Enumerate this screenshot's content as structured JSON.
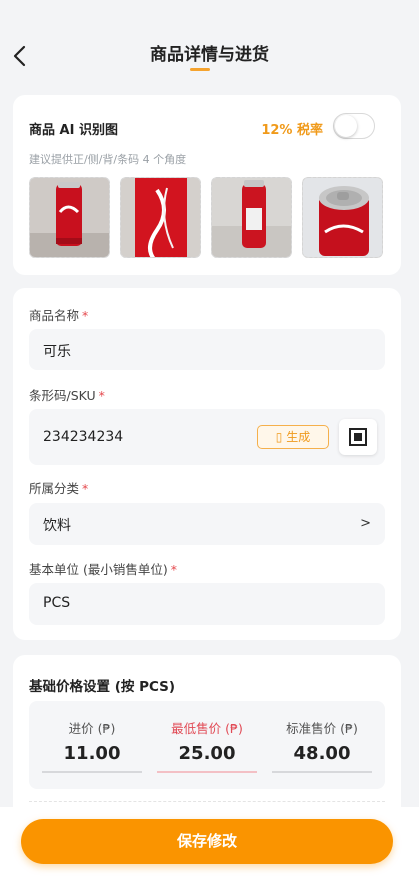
{
  "header": {
    "title": "商品详情与进货"
  },
  "ai_section": {
    "title": "商品 AI 识别图",
    "tax_label": "12% 税率",
    "tax_enabled": false,
    "hint": "建议提供正/侧/背/条码 4 个角度"
  },
  "form": {
    "name": {
      "label": "商品名称",
      "required_mark": "*",
      "value": "可乐"
    },
    "sku": {
      "label": "条形码/SKU",
      "required_mark": "*",
      "value": "234234234",
      "generate_label": "▯ 生成"
    },
    "category": {
      "label": "所属分类",
      "required_mark": "*",
      "value": "饮料",
      "chevron": ">"
    },
    "unit": {
      "label": "基本单位 (最小销售单位)",
      "required_mark": "*",
      "value": "PCS"
    }
  },
  "pricing": {
    "title": "基础价格设置 (按 PCS)",
    "cost": {
      "label": "进价 (₱)",
      "value": "11.00"
    },
    "min_price": {
      "label": "最低售价 (₱)",
      "value": "25.00"
    },
    "std_price": {
      "label": "标准售价 (₱)",
      "value": "48.00"
    }
  },
  "footer": {
    "save_label": "保存修改"
  },
  "colors": {
    "accent": "#fa9400",
    "required": "#e5484d",
    "highlight": "#e14a55"
  }
}
